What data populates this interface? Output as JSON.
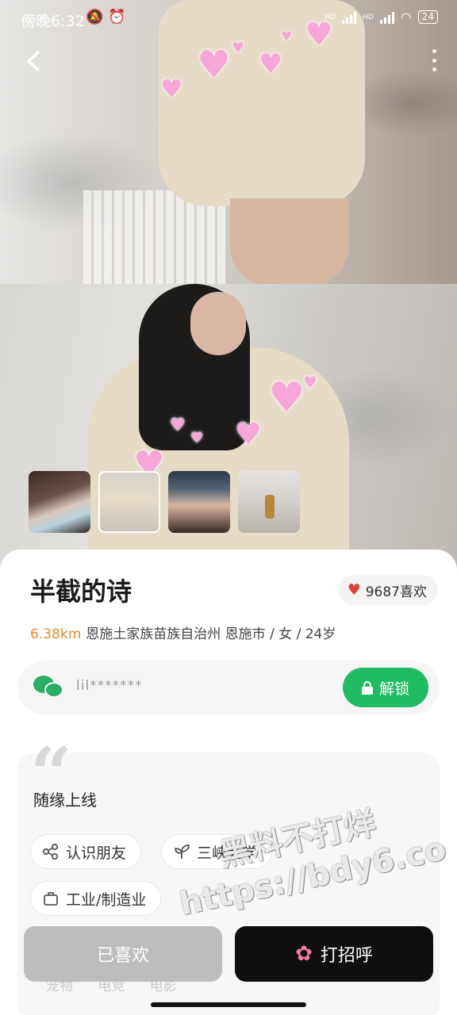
{
  "status_bar": {
    "time": "傍晚6:32",
    "left_icons": [
      "bell-off-icon",
      "alarm-icon"
    ],
    "signal_label_1": "HD",
    "signal_label_2": "HD",
    "battery": "24"
  },
  "header": {
    "back_icon": "chevron-left-icon",
    "more_icon": "more-vertical-icon"
  },
  "thumbnails": [
    {
      "name": "thumbnail-1",
      "active": false
    },
    {
      "name": "thumbnail-2",
      "active": true
    },
    {
      "name": "thumbnail-3",
      "active": false
    },
    {
      "name": "thumbnail-4",
      "active": false
    }
  ],
  "profile": {
    "name": "半截的诗",
    "likes": "9687喜欢",
    "distance": "6.38km",
    "location": "恩施土家族苗族自治州 恩施市 / 女 / 24岁"
  },
  "contact": {
    "wechat_id": "lil*******",
    "unlock_label": "解锁"
  },
  "bio": {
    "text": "随缘上线",
    "tags": [
      "认识朋友",
      "三峡大学",
      "工业/制造业"
    ],
    "hidden_row": "宠物 电竞 电影"
  },
  "actions": {
    "liked_label": "已喜欢",
    "greet_label": "打招呼"
  },
  "watermark": {
    "line1": "黑料不打烊",
    "line2": "https://bdy6.co"
  },
  "colors": {
    "accent_green": "#1fbc62",
    "distance_orange": "#e8892b",
    "like_red": "#e0403a",
    "greet_black": "#0f0f0f",
    "liked_gray": "#bdbdbd"
  }
}
